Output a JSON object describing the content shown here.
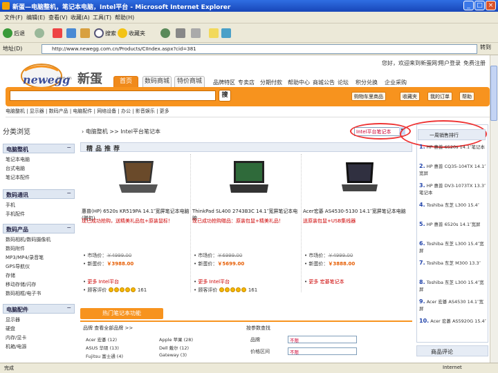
{
  "window": {
    "title": "新蛋—电脑整机，笔记本电脑，Intel平台 - Microsoft Internet Explorer",
    "btn_min": "_",
    "btn_max": "□",
    "btn_close": "×"
  },
  "menu": [
    "文件(F)",
    "编辑(E)",
    "查看(V)",
    "收藏(A)",
    "工具(T)",
    "帮助(H)"
  ],
  "toolbar": {
    "back": "后退",
    "search": "搜索",
    "favorites": "收藏夹"
  },
  "address": {
    "label": "地址(D)",
    "url": "http://www.newegg.com.cn/Products/CIIndex.aspx?cid=381",
    "go": "转到"
  },
  "site": {
    "logo_text": "newegg",
    "logo_sub": ".com.cn",
    "logo_cn": "新蛋",
    "toplinks": [
      "您好，欢迎来到新蛋网！",
      "用户登录",
      "免费注册"
    ],
    "tabs": [
      "首页",
      "数码商城",
      "特价商城"
    ],
    "navlinks": [
      "品牌特区",
      "专卖店",
      "分期付款",
      "帮助中心",
      "商城公告",
      "论坛",
      "积分兑换",
      "企业采购"
    ],
    "search_btn": "搜",
    "cart_links": [
      "购物车里商品",
      "收藏夹",
      "我的订单",
      "帮助"
    ],
    "subnav": "电脑整机 | 显示器 | 数码产品 | 电脑配件 | 网络设备 | 办公 | 影音娱乐 | 更多"
  },
  "sidebar": {
    "title": "分类浏览",
    "categories": [
      {
        "name": "电脑整机",
        "items": [
          "笔记本电脑",
          "台式电脑",
          "笔记本配件"
        ]
      },
      {
        "name": "数码通讯",
        "items": [
          "手机",
          "手机配件"
        ]
      },
      {
        "name": "数码产品",
        "items": [
          "数码相机/数码摄像机",
          "数码附件",
          "MP3/MP4/录音笔",
          "GPS导航仪",
          "存储",
          "移动存储/闪存",
          "数码相框/电子书"
        ]
      },
      {
        "name": "电脑配件",
        "items": [
          "显示器",
          "硬盘",
          "内存/显卡",
          "机箱/电源"
        ]
      }
    ]
  },
  "breadcrumb": "› 电脑整机 >> Intel平台笔记本",
  "select_value": "Intel平台笔记本",
  "recommend": "精品推荐",
  "products": [
    {
      "name": "惠普(HP) 6520s KR519PA 14.1″宽屏笔记本电脑(赠包)",
      "promo": "现已成功抢购，送精美礼品包+原装鼠标！",
      "market_label": "市场价：",
      "market_price": "￥4999.00",
      "sale_label": "新蛋价：",
      "sale_price": "￥3988.00",
      "more": "更多 Intel平台",
      "review": "顾客评价"
    },
    {
      "name": "ThinkPad SL400 2743B3C 14.1″宽屏笔记本电脑",
      "promo": "现已成功抢购赠品：原装包鼠+精美礼品！",
      "market_label": "市场价：",
      "market_price": "￥6999.00",
      "sale_label": "新蛋价：",
      "sale_price": "￥5699.00",
      "more": "更多 Intel平台",
      "review": "顾客评价"
    },
    {
      "name": "Acer宏碁 AS4530-5130 14.1″宽屏笔记本电脑",
      "promo": "送原装包鼠+USB集线器",
      "market_label": "市场价：",
      "market_price": "￥4999.00",
      "sale_label": "新蛋价：",
      "sale_price": "￥3888.00",
      "more": "更多 宏碁笔记本",
      "review": ""
    }
  ],
  "stars_label": "161",
  "hot_button": "热门笔记本功能",
  "brand_section": {
    "title": "品牌 查看全部品牌 >>",
    "brands": [
      "Acer 宏碁 (12)",
      "ASUS 华硕 (13)",
      "Fujitsu 富士通 (4)",
      "Apple 苹果 (28)",
      "Dell 戴尔 (12)",
      "Gateway (3)"
    ]
  },
  "search_form": {
    "title": "按参数查找",
    "labels": [
      "品牌",
      "价格区间"
    ],
    "values": [
      "不限",
      "不限"
    ]
  },
  "ranking": {
    "title": "一周销售排行",
    "items": [
      "HP 惠普 6520s 14.1″笔记本",
      "HP 惠普 CQ35-104TX 14.1″宽屏",
      "HP 惠普 DV3-1073TX 13.3″笔记本",
      "Toshiba 东芝 L300 15.4″",
      "HP 惠普 6520s 14.1″宽屏",
      "Toshiba 东芝 L300 15.4″宽屏",
      "Toshiba 东芝 M300 13.3″",
      "Toshiba 东芝 L300 15.4″宽屏",
      "Acer 宏碁 AS4530 14.1″宽屏",
      "Acer 宏碁 AS5920G 15.4″"
    ]
  },
  "comments_title": "商品评论",
  "status": {
    "left": "完成",
    "right": "Internet"
  }
}
